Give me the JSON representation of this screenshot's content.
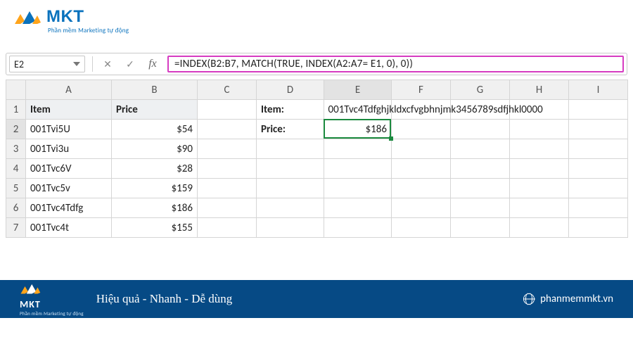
{
  "brand": {
    "name": "MKT",
    "tagline": "Phần mềm Marketing tự động",
    "colors": {
      "blue": "#0a72bd",
      "orange": "#ffa41b",
      "magenta": "#d63cc1",
      "footer": "#064a85",
      "sel_green": "#1b8a3f"
    }
  },
  "formula_bar": {
    "cell_ref": "E2",
    "formula": "=INDEX(B2:B7, MATCH(TRUE, INDEX(A2:A7= E1, 0), 0))"
  },
  "columns": [
    "A",
    "B",
    "C",
    "D",
    "E",
    "F",
    "G",
    "H",
    "I"
  ],
  "headers": {
    "A": "Item",
    "B": "Price",
    "D": "Item:",
    "D2": "Price:"
  },
  "rows": [
    {
      "n": 1,
      "A": "Item",
      "B": "Price",
      "D": "Item:",
      "E": "001Tvc4Tdfghjkldxcfvgbhnjmk3456789sdfjhkl0000"
    },
    {
      "n": 2,
      "A": "001Tvi5U",
      "B": "$54",
      "D": "Price:",
      "E": "$186"
    },
    {
      "n": 3,
      "A": "001Tvi3u",
      "B": "$90"
    },
    {
      "n": 4,
      "A": "001Tvc6V",
      "B": "$28"
    },
    {
      "n": 5,
      "A": "001Tvc5v",
      "B": "$159"
    },
    {
      "n": 6,
      "A": "001Tvc4Tdfg",
      "B": "$186"
    },
    {
      "n": 7,
      "A": "001Tvc4t",
      "B": "$155"
    }
  ],
  "footer": {
    "slogan": "Hiệu quả - Nhanh  - Dễ dùng",
    "site": "phanmemmkt.vn"
  }
}
